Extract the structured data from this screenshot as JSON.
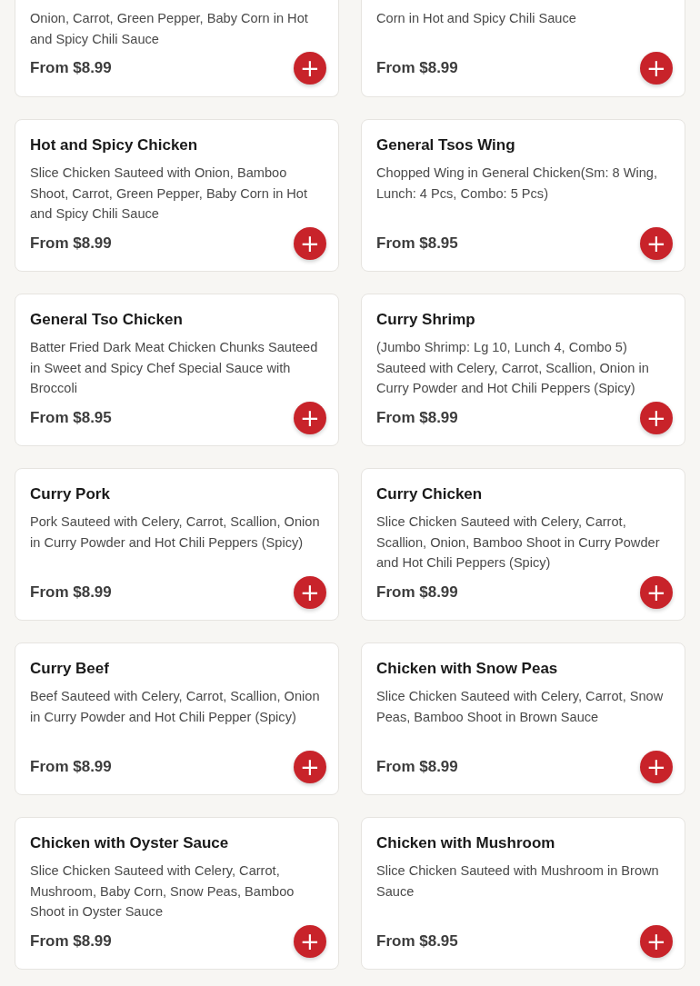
{
  "menu_items": [
    {
      "description": "Onion, Carrot, Green Pepper, Baby Corn in Hot and Spicy Chili Sauce",
      "price": "From $8.99",
      "add_label": "+"
    },
    {
      "description": "Corn in Hot and Spicy Chili Sauce",
      "price": "From $8.99",
      "add_label": "+"
    },
    {
      "name": "Hot and Spicy Chicken",
      "description": "Slice Chicken Sauteed with Onion, Bamboo Shoot, Carrot, Green Pepper, Baby Corn in Hot and Spicy Chili Sauce",
      "price": "From $8.99",
      "add_label": "+"
    },
    {
      "name": "General Tsos Wing",
      "description": "Chopped Wing in General Chicken(Sm: 8 Wing, Lunch: 4 Pcs, Combo: 5 Pcs)",
      "price": "From $8.95",
      "add_label": "+"
    },
    {
      "name": "General Tso Chicken",
      "description": "Batter Fried Dark Meat Chicken Chunks Sauteed in Sweet and Spicy Chef Special Sauce with Broccoli",
      "price": "From $8.95",
      "add_label": "+"
    },
    {
      "name": "Curry Shrimp",
      "description": "(Jumbo Shrimp: Lg 10, Lunch 4, Combo 5) Sauteed with Celery, Carrot, Scallion, Onion in Curry Powder and Hot Chili Peppers (Spicy)",
      "price": "From $8.99",
      "add_label": "+"
    },
    {
      "name": "Curry Pork",
      "description": "Pork Sauteed with Celery, Carrot, Scallion, Onion in Curry Powder and Hot Chili Peppers (Spicy)",
      "price": "From $8.99",
      "add_label": "+"
    },
    {
      "name": "Curry Chicken",
      "description": "Slice Chicken Sauteed with Celery, Carrot, Scallion, Onion, Bamboo Shoot in Curry Powder and Hot Chili Peppers (Spicy)",
      "price": "From $8.99",
      "add_label": "+"
    },
    {
      "name": "Curry Beef",
      "description": "Beef Sauteed with Celery, Carrot, Scallion, Onion in Curry Powder and Hot Chili Pepper (Spicy)",
      "price": "From $8.99",
      "add_label": "+"
    },
    {
      "name": "Chicken with Snow Peas",
      "description": "Slice Chicken Sauteed with Celery, Carrot, Snow Peas, Bamboo Shoot in Brown Sauce",
      "price": "From $8.99",
      "add_label": "+"
    },
    {
      "name": "Chicken with Oyster Sauce",
      "description": "Slice Chicken Sauteed with Celery, Carrot, Mushroom, Baby Corn, Snow Peas, Bamboo Shoot in Oyster Sauce",
      "price": "From $8.99",
      "add_label": "+"
    },
    {
      "name": "Chicken with Mushroom",
      "description": "Slice Chicken Sauteed with Mushroom in Brown Sauce",
      "price": "From $8.95",
      "add_label": "+"
    }
  ]
}
